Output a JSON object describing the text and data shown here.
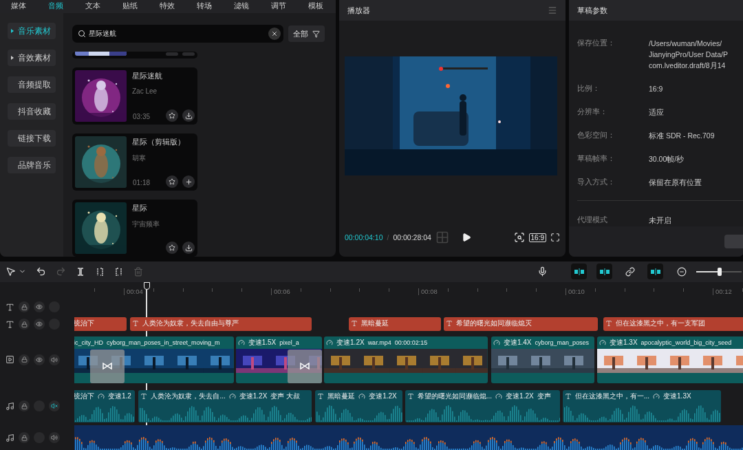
{
  "left_panel": {
    "tabs": [
      {
        "label": "媒体",
        "selected": false
      },
      {
        "label": "音频",
        "selected": true
      },
      {
        "label": "文本",
        "selected": false
      },
      {
        "label": "贴纸",
        "selected": false
      },
      {
        "label": "特效",
        "selected": false
      },
      {
        "label": "转场",
        "selected": false
      },
      {
        "label": "滤镜",
        "selected": false
      },
      {
        "label": "调节",
        "selected": false
      },
      {
        "label": "模板",
        "selected": false
      }
    ],
    "sidebar": [
      {
        "label": "音乐素材",
        "selected": true,
        "expandable": true
      },
      {
        "label": "音效素材",
        "selected": false,
        "expandable": true
      },
      {
        "label": "音频提取",
        "selected": false,
        "expandable": false
      },
      {
        "label": "抖音收藏",
        "selected": false,
        "expandable": false
      },
      {
        "label": "链接下载",
        "selected": false,
        "expandable": false
      },
      {
        "label": "品牌音乐",
        "selected": false,
        "expandable": false
      }
    ],
    "search": {
      "value": "星际迷航"
    },
    "filter": {
      "label": "全部"
    },
    "tracks": [
      {
        "kind": "partial"
      },
      {
        "kind": "full",
        "title": "星际迷航",
        "artist": "Zac Lee",
        "duration": "03:35",
        "downloaded": false
      },
      {
        "kind": "full",
        "title": "星际（剪辑版）",
        "artist": "胡寒",
        "duration": "01:18",
        "downloaded": true
      },
      {
        "kind": "full",
        "title": "星际",
        "artist": "宇宙频率",
        "downloaded": false
      }
    ]
  },
  "player": {
    "title": "播放器",
    "current_time": "00:00:04:10",
    "separator": "/",
    "total_time": "00:00:28:04",
    "ratio": "16:9"
  },
  "params": {
    "title": "草稿参数",
    "rows": [
      {
        "label": "保存位置：",
        "value_lines": [
          "/Users/wuman/Movies/",
          "JianyingPro/User Data/P",
          "com.lveditor.draft/8月14"
        ]
      },
      {
        "label": "比例：",
        "value_lines": [
          "16:9"
        ]
      },
      {
        "label": "分辨率：",
        "value_lines": [
          "适应"
        ]
      },
      {
        "label": "色彩空间：",
        "value_lines": [
          "标准 SDR - Rec.709"
        ]
      },
      {
        "label": "草稿帧率：",
        "value_lines": [
          "30.00帧/秒"
        ]
      },
      {
        "label": "导入方式：",
        "value_lines": [
          "保留在原有位置"
        ]
      }
    ],
    "proxy": {
      "label": "代理模式",
      "value": "未开启"
    }
  },
  "timeline": {
    "toggles": [
      {
        "selected": true
      },
      {
        "selected": true
      },
      {
        "selected": false
      },
      {
        "selected": true
      }
    ],
    "zoom": {
      "level": 0.52
    },
    "ruler": [
      "00:04",
      "00:06",
      "00:08",
      "00:10",
      "00:12"
    ],
    "tracks": [
      {
        "kind": "text",
        "eye": true,
        "sound": false
      },
      {
        "kind": "text",
        "eye": true,
        "sound": false,
        "clips": [
          {
            "labels": [
              {
                "kind": "plain",
                "text": "统治下"
              }
            ]
          },
          {
            "labels": [
              {
                "kind": "text",
                "text": "人类沦为奴隶，失去自由与尊严"
              }
            ]
          },
          {
            "labels": [
              {
                "kind": "text",
                "text": "黑暗蔓延"
              }
            ]
          },
          {
            "labels": [
              {
                "kind": "text",
                "text": "希望的曙光如同濒临熄灭"
              }
            ]
          },
          {
            "labels": [
              {
                "kind": "text",
                "text": "但在这漆黑之中，有一支军团"
              }
            ]
          }
        ]
      },
      {
        "kind": "video",
        "eye": true,
        "sound": true,
        "muted": false,
        "transitions": [
          {
            "kind": "transition"
          },
          {
            "kind": "transition"
          }
        ],
        "clips": [
          {
            "labels": [
              {
                "kind": "plain",
                "text": "ic_city_HD"
              },
              {
                "kind": "plain",
                "text": "cyborg_man_poses_in_street_moving_m"
              }
            ]
          },
          {
            "labels": [
              {
                "kind": "speed",
                "text": "变速1.5X"
              },
              {
                "kind": "plain",
                "text": "pixel_a"
              }
            ]
          },
          {
            "labels": [
              {
                "kind": "speed",
                "text": "变速1.2X"
              },
              {
                "kind": "plain",
                "text": "war.mp4"
              },
              {
                "kind": "plain",
                "text": "00:00:02:15"
              }
            ]
          },
          {
            "labels": [
              {
                "kind": "speed",
                "text": "变速1.4X"
              },
              {
                "kind": "plain",
                "text": "cyborg_man_poses"
              }
            ]
          },
          {
            "labels": [
              {
                "kind": "speed",
                "text": "变速1.3X"
              },
              {
                "kind": "plain",
                "text": "apocalyptic_world_big_city_seed"
              }
            ]
          }
        ]
      },
      {
        "kind": "audio",
        "eye": false,
        "sound": true,
        "muted": true,
        "clips": [
          {
            "labels": [
              {
                "kind": "plain",
                "text": "统治下"
              },
              {
                "kind": "speed",
                "text": "变速1.2"
              }
            ]
          },
          {
            "labels": [
              {
                "kind": "text",
                "text": "人类沦为奴隶，失去自..."
              },
              {
                "kind": "speed",
                "text": "变速1.2X"
              },
              {
                "kind": "plain",
                "text": "变声 大叔"
              }
            ]
          },
          {
            "labels": [
              {
                "kind": "text",
                "text": "黑暗蔓延"
              },
              {
                "kind": "speed",
                "text": "变速1.2X"
              }
            ]
          },
          {
            "labels": [
              {
                "kind": "text",
                "text": "希望的曙光如同濒临熄..."
              },
              {
                "kind": "speed",
                "text": "变速1.2X"
              },
              {
                "kind": "plain",
                "text": "变声"
              }
            ]
          },
          {
            "labels": [
              {
                "kind": "text",
                "text": "但在这漆黑之中，有一..."
              },
              {
                "kind": "speed",
                "text": "变速1.3X"
              }
            ]
          }
        ]
      },
      {
        "kind": "music",
        "eye": false,
        "sound": true,
        "muted": false,
        "clips": [
          {
            "kind": "music"
          }
        ]
      }
    ]
  }
}
